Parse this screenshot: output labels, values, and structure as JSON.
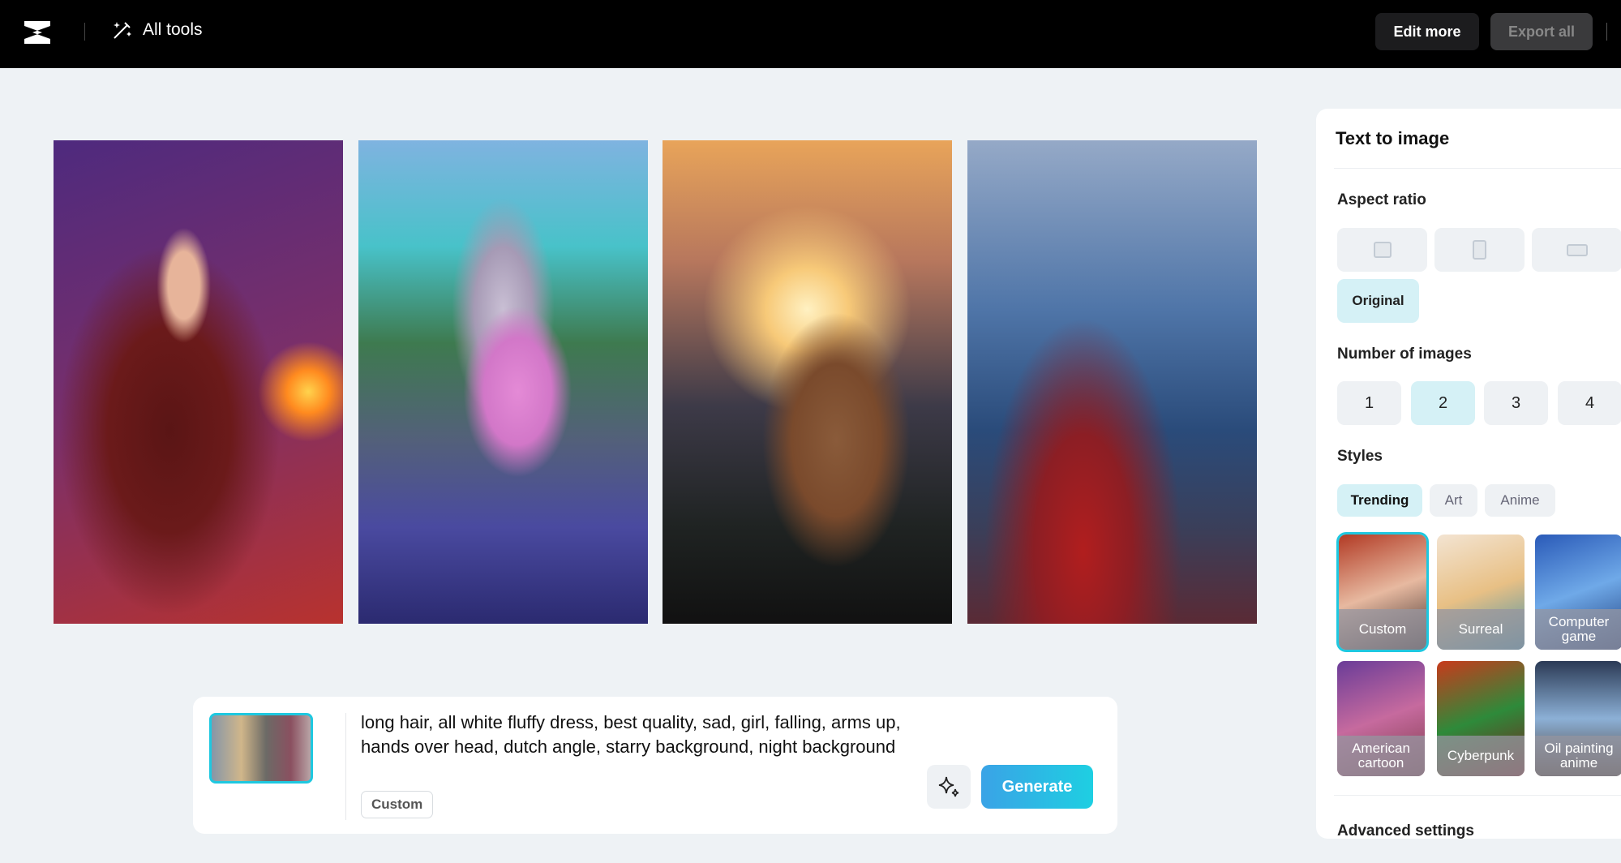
{
  "header": {
    "all_tools": "All tools",
    "edit_more": "Edit more",
    "export_all": "Export all"
  },
  "panel": {
    "title": "Text to image",
    "aspect_ratio_label": "Aspect ratio",
    "aspect_options": [
      "square",
      "portrait",
      "landscape"
    ],
    "original": "Original",
    "number_label": "Number of images",
    "numbers": [
      "1",
      "2",
      "3",
      "4"
    ],
    "selected_number": "2",
    "styles_label": "Styles",
    "style_tabs": [
      "Trending",
      "Art",
      "Anime"
    ],
    "styles": [
      "Custom",
      "Surreal",
      "Computer game",
      "American cartoon",
      "Cyberpunk",
      "Oil painting anime"
    ],
    "selected_style": "Custom",
    "advanced": "Advanced settings"
  },
  "prompt": {
    "text": "long hair, all white fluffy dress, best quality, sad, girl, falling, arms up, hands over head, dutch angle, starry background, night background",
    "style_tag": "Custom",
    "generate": "Generate"
  },
  "colors": {
    "accent": "#1ec8e0",
    "selected_bg": "#d5f1f6"
  }
}
